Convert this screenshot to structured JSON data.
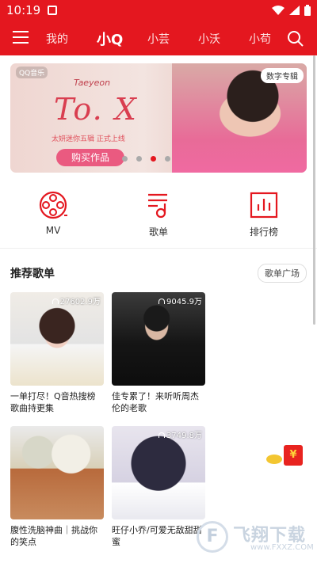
{
  "status": {
    "time": "10:19"
  },
  "tabs": [
    {
      "label": "我的"
    },
    {
      "label": "小Q"
    },
    {
      "label": "小芸"
    },
    {
      "label": "小沃"
    },
    {
      "label": "小苟"
    }
  ],
  "banner": {
    "logo": "QQ音乐",
    "signature": "Taeyeon",
    "album_title": "To. X",
    "tagline": "太妍迷你五辑 正式上线",
    "buy_button": "购买作品",
    "tag": "数字专辑",
    "dot_count": 4,
    "active_dot_index": 2
  },
  "quick_actions": [
    {
      "label": "MV",
      "icon": "film-reel-icon"
    },
    {
      "label": "歌单",
      "icon": "playlist-note-icon"
    },
    {
      "label": "排行榜",
      "icon": "bar-chart-icon"
    }
  ],
  "recommended": {
    "title": "推荐歌单",
    "more_button": "歌单广场",
    "playlists": [
      {
        "plays": "27602.9万",
        "title": "一单打尽！Q音热搜榜歌曲持更集"
      },
      {
        "plays": "9045.9万",
        "title": "佳专累了！来听听周杰伦的老歌"
      },
      {
        "plays": "",
        "title": "腹性洗脑神曲｜挑战你的笑点"
      },
      {
        "plays": "3749.8万",
        "title": "旺仔小乔/可爱无敌甜甜蜜"
      }
    ]
  },
  "floating": {
    "redpacket_symbol": "¥"
  },
  "watermark": {
    "name": "飞翔下载",
    "url": "www.FXXZ.COM"
  },
  "colors": {
    "primary": "#e4171f",
    "accent_pink": "#ea5a80"
  }
}
